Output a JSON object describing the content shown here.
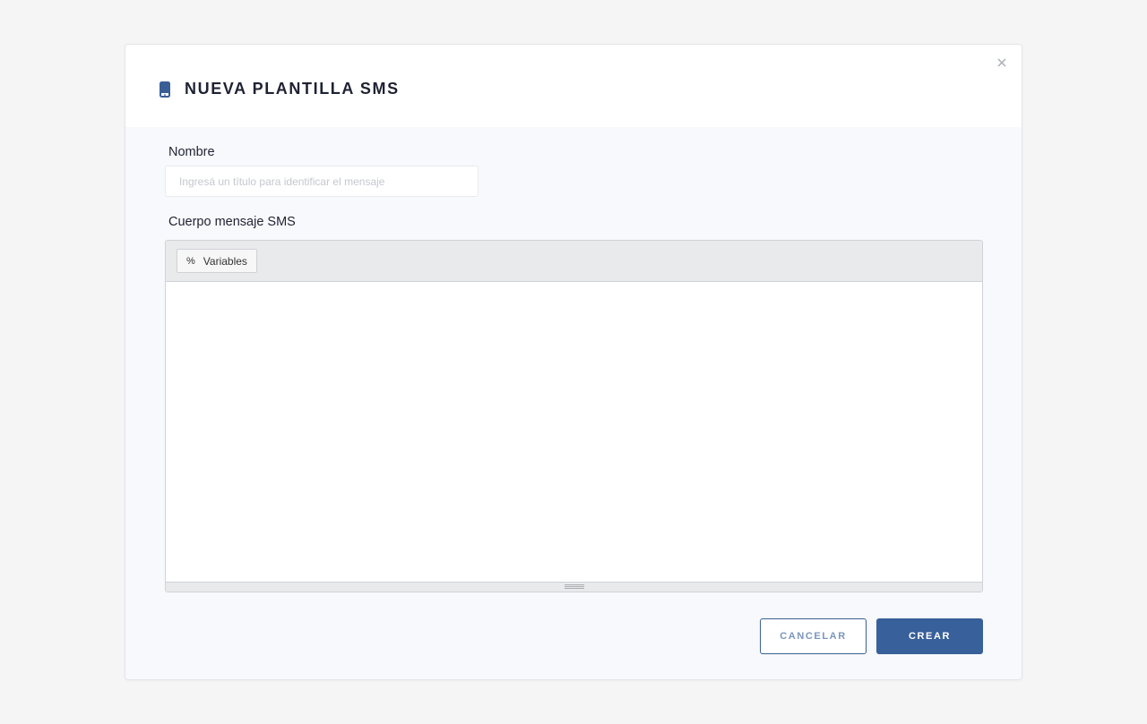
{
  "modal": {
    "title": "NUEVA PLANTILLA SMS",
    "title_icon": "mobile-phone-icon",
    "close_icon": "close-icon"
  },
  "form": {
    "name_label": "Nombre",
    "name_placeholder": "Ingresá un título para identificar el mensaje",
    "name_value": "",
    "body_label": "Cuerpo mensaje SMS",
    "body_value": ""
  },
  "editor": {
    "variables_label": "Variables",
    "variables_icon_glyph": "%"
  },
  "actions": {
    "cancel_label": "CANCELAR",
    "create_label": "CREAR"
  },
  "colors": {
    "accent": "#38609a",
    "icon": "#3a5f96"
  }
}
